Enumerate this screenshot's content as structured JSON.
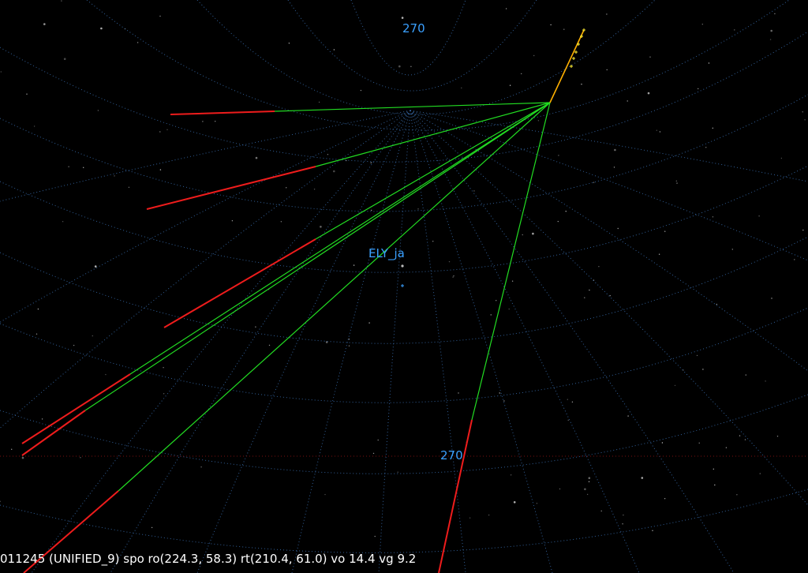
{
  "view": {
    "grid_labels": {
      "top": "270",
      "bottom": "270"
    },
    "station_label": "ELY_ja"
  },
  "status_bar": {
    "text": "011245 (UNIFIED_9) spo ro(224.3, 58.3) rt(210.4, 61.0) vo 14.4 vg 9.2"
  },
  "colors": {
    "background": "#000000",
    "grid": "#3a6fb0",
    "label": "#3aa0ff",
    "ray_near": "#22dd22",
    "ray_far": "#ee1c1c",
    "track": "#ffb000",
    "track_marker": "#ffee33",
    "star": "#c8c8c8",
    "status_text": "#ffffff"
  }
}
